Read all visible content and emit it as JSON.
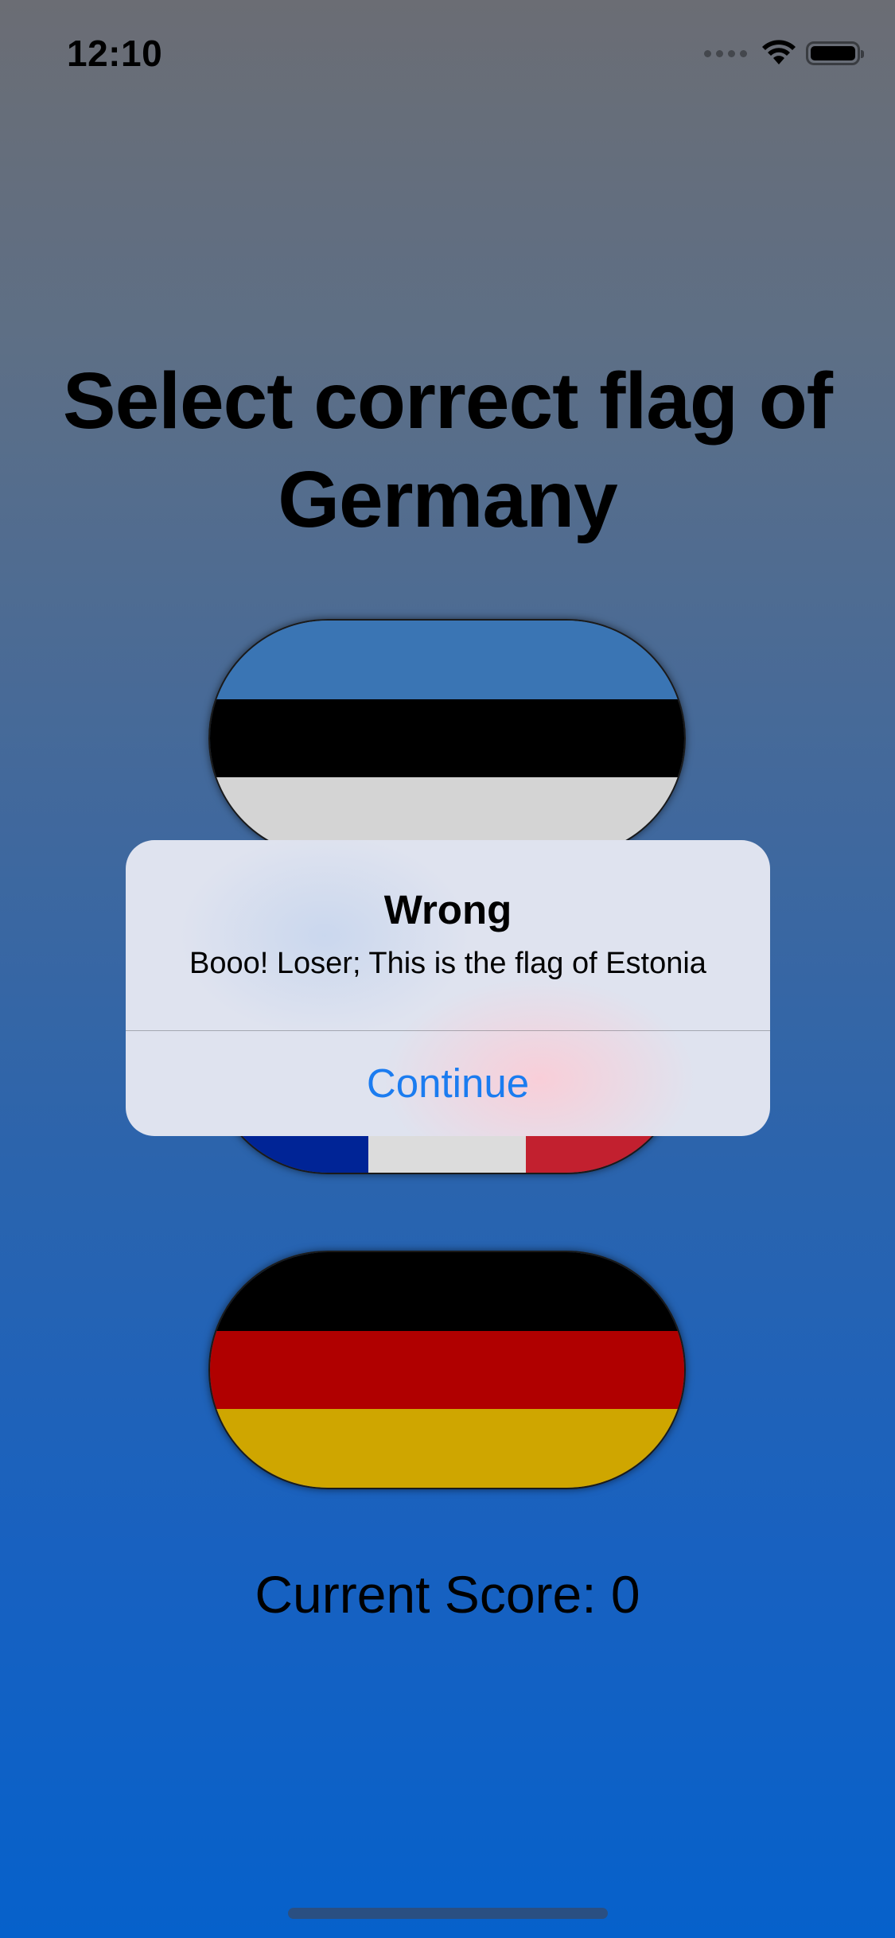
{
  "status_bar": {
    "time": "12:10",
    "icons": [
      "signal-icon",
      "wifi-icon",
      "battery-icon"
    ]
  },
  "prompt": {
    "title": "Select correct flag of Germany"
  },
  "flags": [
    {
      "country": "Estonia",
      "colors": [
        "#3a75b4",
        "#000000",
        "#d4d4d4"
      ],
      "orientation": "horizontal"
    },
    {
      "country": "France",
      "colors": [
        "#002496",
        "#dcdcdc",
        "#c2202f"
      ],
      "orientation": "vertical"
    },
    {
      "country": "Germany",
      "colors": [
        "#000000",
        "#b00000",
        "#cfa600"
      ],
      "orientation": "horizontal"
    }
  ],
  "score": {
    "text": "Current Score: 0"
  },
  "alert": {
    "title": "Wrong",
    "message": "Booo! Loser; This is the flag of Estonia",
    "action_label": "Continue",
    "action_color": "#1b7cf0"
  }
}
